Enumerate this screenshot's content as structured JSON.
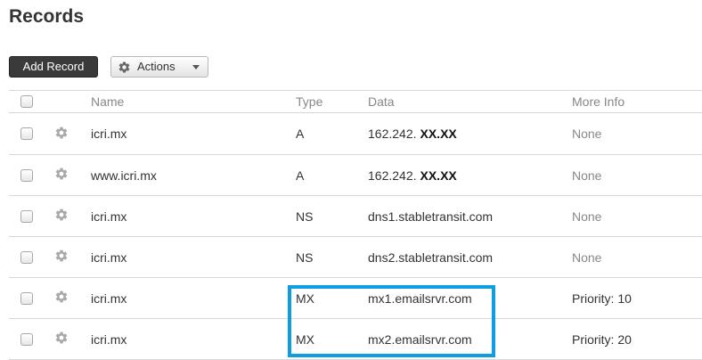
{
  "page": {
    "title": "Records"
  },
  "toolbar": {
    "add_label": "Add Record",
    "actions_label": "Actions"
  },
  "table": {
    "columns": {
      "name": "Name",
      "type": "Type",
      "data": "Data",
      "more_info": "More Info"
    },
    "rows": [
      {
        "name": "icri.mx",
        "type": "A",
        "data": "162.242.",
        "data_masked": "XX.XX",
        "more_info": "None"
      },
      {
        "name": "www.icri.mx",
        "type": "A",
        "data": "162.242.",
        "data_masked": "XX.XX",
        "more_info": "None"
      },
      {
        "name": "icri.mx",
        "type": "NS",
        "data": "dns1.stabletransit.com",
        "data_masked": "",
        "more_info": "None"
      },
      {
        "name": "icri.mx",
        "type": "NS",
        "data": "dns2.stabletransit.com",
        "data_masked": "",
        "more_info": "None"
      },
      {
        "name": "icri.mx",
        "type": "MX",
        "data": "mx1.emailsrvr.com",
        "data_masked": "",
        "more_info": "Priority: 10"
      },
      {
        "name": "icri.mx",
        "type": "MX",
        "data": "mx2.emailsrvr.com",
        "data_masked": "",
        "more_info": "Priority: 20"
      }
    ]
  },
  "colors": {
    "highlight": "#0e9de0",
    "primary_button": "#3a3a3a",
    "muted_text": "#888888"
  },
  "icons": {
    "row_action": "gear-icon",
    "actions_menu": "gear-icon",
    "dropdown": "caret-down-icon"
  }
}
